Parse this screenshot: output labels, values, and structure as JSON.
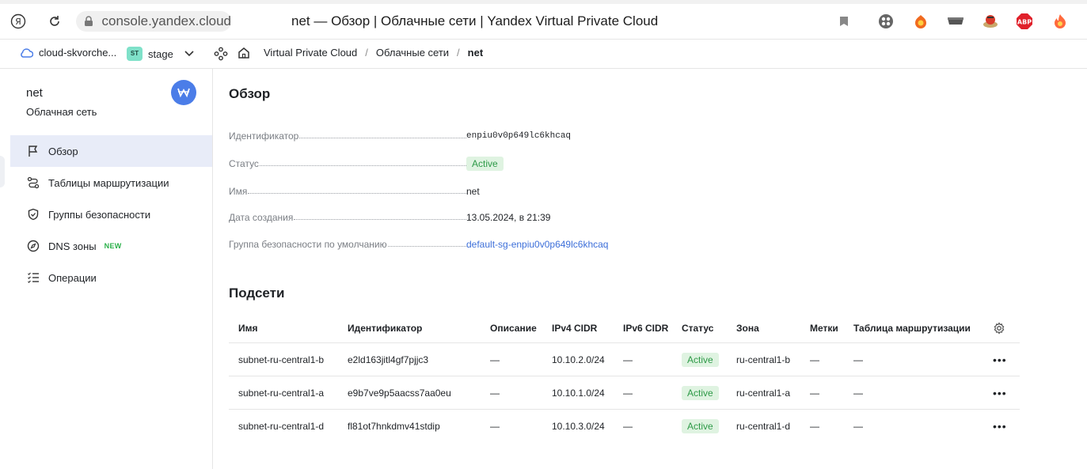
{
  "browser": {
    "url": "console.yandex.cloud",
    "title": "net — Обзор | Облачные сети | Yandex Virtual Private Cloud",
    "extensions": [
      "bookmark-icon",
      "extension-grid-icon",
      "fox-icon",
      "hat-icon",
      "pie-icon",
      "abp-icon",
      "flame-icon"
    ],
    "abp_label": "ABP"
  },
  "header": {
    "cloud_name": "cloud-skvorche...",
    "folder_badge": "ST",
    "folder_name": "stage",
    "breadcrumbs": [
      "Virtual Private Cloud",
      "Облачные сети",
      "net"
    ],
    "separator": "/"
  },
  "sidebar": {
    "title": "net",
    "subtitle": "Облачная сеть",
    "items": [
      {
        "label": "Обзор",
        "icon": "flag-icon",
        "active": true
      },
      {
        "label": "Таблицы маршрутизации",
        "icon": "route-icon"
      },
      {
        "label": "Группы безопасности",
        "icon": "shield-icon"
      },
      {
        "label": "DNS зоны",
        "icon": "compass-icon",
        "badge": "NEW"
      },
      {
        "label": "Операции",
        "icon": "list-icon"
      }
    ]
  },
  "overview": {
    "heading": "Обзор",
    "properties": [
      {
        "label": "Идентификатор",
        "value": "enpiu0v0p649lc6khcaq"
      },
      {
        "label": "Статус",
        "value": "Active"
      },
      {
        "label": "Имя",
        "value": "net"
      },
      {
        "label": "Дата создания",
        "value": "13.05.2024, в 21:39"
      },
      {
        "label": "Группа безопасности по умолчанию",
        "value": "default-sg-enpiu0v0p649lc6khcaq"
      }
    ]
  },
  "subnets": {
    "heading": "Подсети",
    "columns": [
      "Имя",
      "Идентификатор",
      "Описание",
      "IPv4 CIDR",
      "IPv6 CIDR",
      "Статус",
      "Зона",
      "Метки",
      "Таблица маршрутизации"
    ],
    "rows": [
      {
        "name": "subnet-ru-central1-b",
        "id": "e2ld163jitl4gf7pjjc3",
        "description": "—",
        "ipv4": "10.10.2.0/24",
        "ipv6": "—",
        "status": "Active",
        "zone": "ru-central1-b",
        "labels": "—",
        "route_table": "—"
      },
      {
        "name": "subnet-ru-central1-a",
        "id": "e9b7ve9p5aacss7aa0eu",
        "description": "—",
        "ipv4": "10.10.1.0/24",
        "ipv6": "—",
        "status": "Active",
        "zone": "ru-central1-a",
        "labels": "—",
        "route_table": "—"
      },
      {
        "name": "subnet-ru-central1-d",
        "id": "fl81ot7hnkdmv41stdip",
        "description": "—",
        "ipv4": "10.10.3.0/24",
        "ipv6": "—",
        "status": "Active",
        "zone": "ru-central1-d",
        "labels": "—",
        "route_table": "—"
      }
    ],
    "row_menu": "•••"
  },
  "colors": {
    "accent": "#4b7de8",
    "active_bg": "#dff3e1",
    "active_text": "#2e9a48",
    "sidebar_active": "#e8ecf8",
    "link": "#3d6fd9"
  }
}
